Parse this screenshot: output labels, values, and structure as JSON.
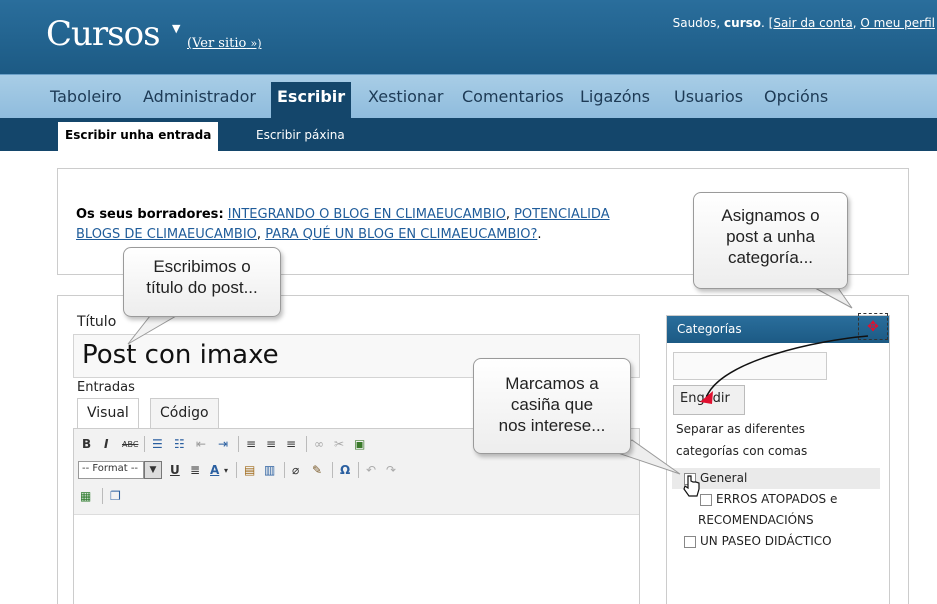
{
  "header": {
    "site_title": "Cursos",
    "ver_sitio": "(Ver sitio",
    "ver_sitio_arrow": "»)",
    "greeting_prefix": "Saudos,",
    "user": "curso",
    "sair": "Sair da conta",
    "perfil": "O meu perfil"
  },
  "menu": {
    "items": [
      "Taboleiro",
      "Administrador",
      "Escribir",
      "Xestionar",
      "Comentarios",
      "Ligazóns",
      "Usuarios",
      "Opcións"
    ],
    "active": "Escribir"
  },
  "submenu": {
    "items": [
      "Escribir unha entrada",
      "Escribir páxina"
    ]
  },
  "drafts": {
    "label": "Os seus borradores",
    "links": [
      "INTEGRANDO O BLOG EN CLIMAEUCAMBIO",
      "POTENCIALIDA",
      "BLOGS DE CLIMAEUCAMBIO",
      "PARA QUÉ UN BLOG EN CLIMAEUCAMBIO?"
    ]
  },
  "post": {
    "title_label": "Título",
    "title_value": "Post con imaxe",
    "content_label": "Entradas",
    "tabs": [
      "Visual",
      "Código"
    ],
    "format_select": "-- Format --"
  },
  "categories": {
    "header": "Categorías",
    "add_button": "Engadir",
    "help_line1": "Separar as diferentes",
    "help_line2": "categorías con comas",
    "items": [
      {
        "label": "General",
        "checked": false
      },
      {
        "label": "ERROS ATOPADOS e",
        "label2": "RECOMENDACIÓNS",
        "checked": false
      },
      {
        "label": "UN PASEO DIDÁCTICO",
        "checked": false
      }
    ]
  },
  "callouts": {
    "titulo": [
      "Escribimos o",
      "título do post..."
    ],
    "categoria": [
      "Asignamos o",
      "post a unha",
      "categoría..."
    ],
    "casinha": [
      "Marcamos a",
      "casiña que",
      "nos interese..."
    ]
  },
  "colors": {
    "header_bg": "#1c5a84",
    "menu_bg": "#a8cde6",
    "submenu_bg": "#14466b",
    "link": "#1f5c9a"
  }
}
